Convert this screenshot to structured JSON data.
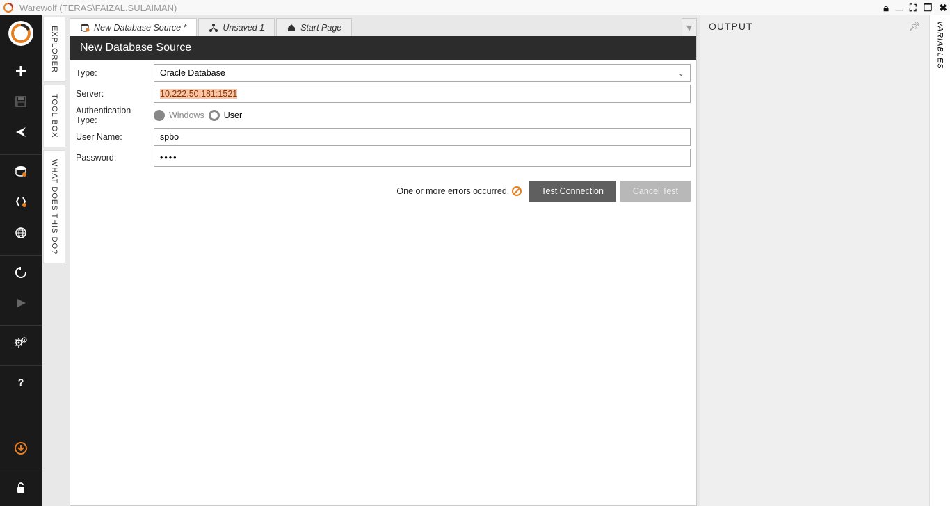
{
  "titlebar": {
    "title": "Warewolf (TERAS\\FAIZAL.SULAIMAN)"
  },
  "vpanels": {
    "explorer": "EXPLORER",
    "toolbox": "TOOL BOX",
    "whatdoes": "WHAT DOES THIS DO?"
  },
  "tabs": [
    {
      "label": "New Database Source *",
      "icon": "database"
    },
    {
      "label": "Unsaved 1",
      "icon": "workflow"
    },
    {
      "label": "Start Page",
      "icon": "home"
    }
  ],
  "card": {
    "header": "New Database Source"
  },
  "form": {
    "type_label": "Type:",
    "type_value": "Oracle Database",
    "server_label": "Server:",
    "server_value": "10.222.50.181:1521",
    "auth_label": "Authentication Type:",
    "auth_windows": "Windows",
    "auth_user": "User",
    "user_label": "User Name:",
    "user_value": "spbo",
    "pass_label": "Password:",
    "pass_value": "••••"
  },
  "buttons": {
    "error_msg": "One or more errors occurred.",
    "test": "Test Connection",
    "cancel": "Cancel Test"
  },
  "output": {
    "title": "OUTPUT"
  },
  "rightpanel": {
    "variables": "VARIABLES"
  }
}
